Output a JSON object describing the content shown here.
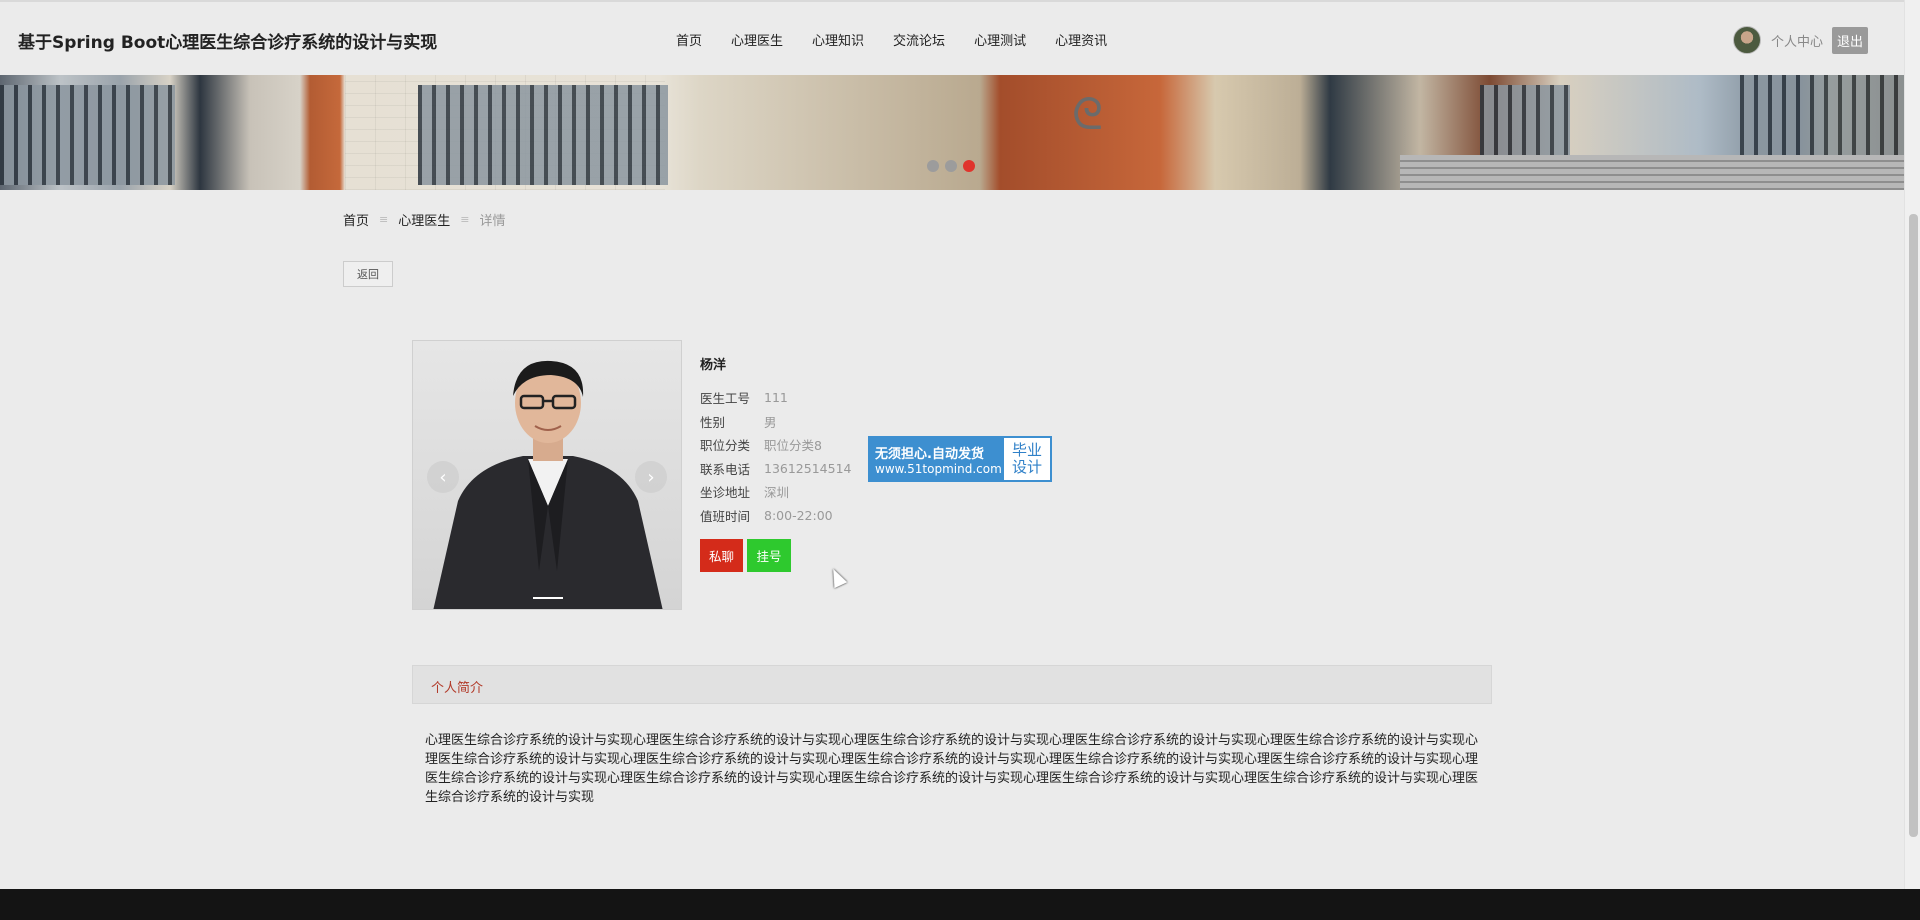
{
  "header": {
    "site_title": "基于Spring Boot心理医生综合诊疗系统的设计与实现",
    "nav": [
      "首页",
      "心理医生",
      "心理知识",
      "交流论坛",
      "心理测试",
      "心理资讯"
    ],
    "user_center": "个人中心",
    "logout": "退出"
  },
  "banner": {
    "slides": 3,
    "active_slide": 3,
    "active_dot_color": "#e0342c"
  },
  "breadcrumb": {
    "home": "首页",
    "section": "心理医生",
    "current": "详情",
    "separator": "≡"
  },
  "back_button": "返回",
  "doctor": {
    "name": "杨洋",
    "fields": [
      {
        "label": "医生工号",
        "value": "111"
      },
      {
        "label": "性别",
        "value": "男"
      },
      {
        "label": "职位分类",
        "value": "职位分类8"
      },
      {
        "label": "联系电话",
        "value": "13612514514"
      },
      {
        "label": "坐诊地址",
        "value": "深圳"
      },
      {
        "label": "值班时间",
        "value": "8:00-22:00"
      }
    ],
    "chat_button": "私聊",
    "register_button": "挂号"
  },
  "ad": {
    "line1": "无须担心.自动发货",
    "line2": "www.51topmind.com",
    "right_top": "毕业",
    "right_bottom": "设计"
  },
  "intro": {
    "tab_label": "个人简介",
    "text": "心理医生综合诊疗系统的设计与实现心理医生综合诊疗系统的设计与实现心理医生综合诊疗系统的设计与实现心理医生综合诊疗系统的设计与实现心理医生综合诊疗系统的设计与实现心理医生综合诊疗系统的设计与实现心理医生综合诊疗系统的设计与实现心理医生综合诊疗系统的设计与实现心理医生综合诊疗系统的设计与实现心理医生综合诊疗系统的设计与实现心理医生综合诊疗系统的设计与实现心理医生综合诊疗系统的设计与实现心理医生综合诊疗系统的设计与实现心理医生综合诊疗系统的设计与实现心理医生综合诊疗系统的设计与实现心理医生综合诊疗系统的设计与实现"
  },
  "colors": {
    "chat_button": "#d42b1a",
    "register_button": "#2ec92e",
    "intro_tab_text": "#b23b2a",
    "footer": "#141414"
  }
}
